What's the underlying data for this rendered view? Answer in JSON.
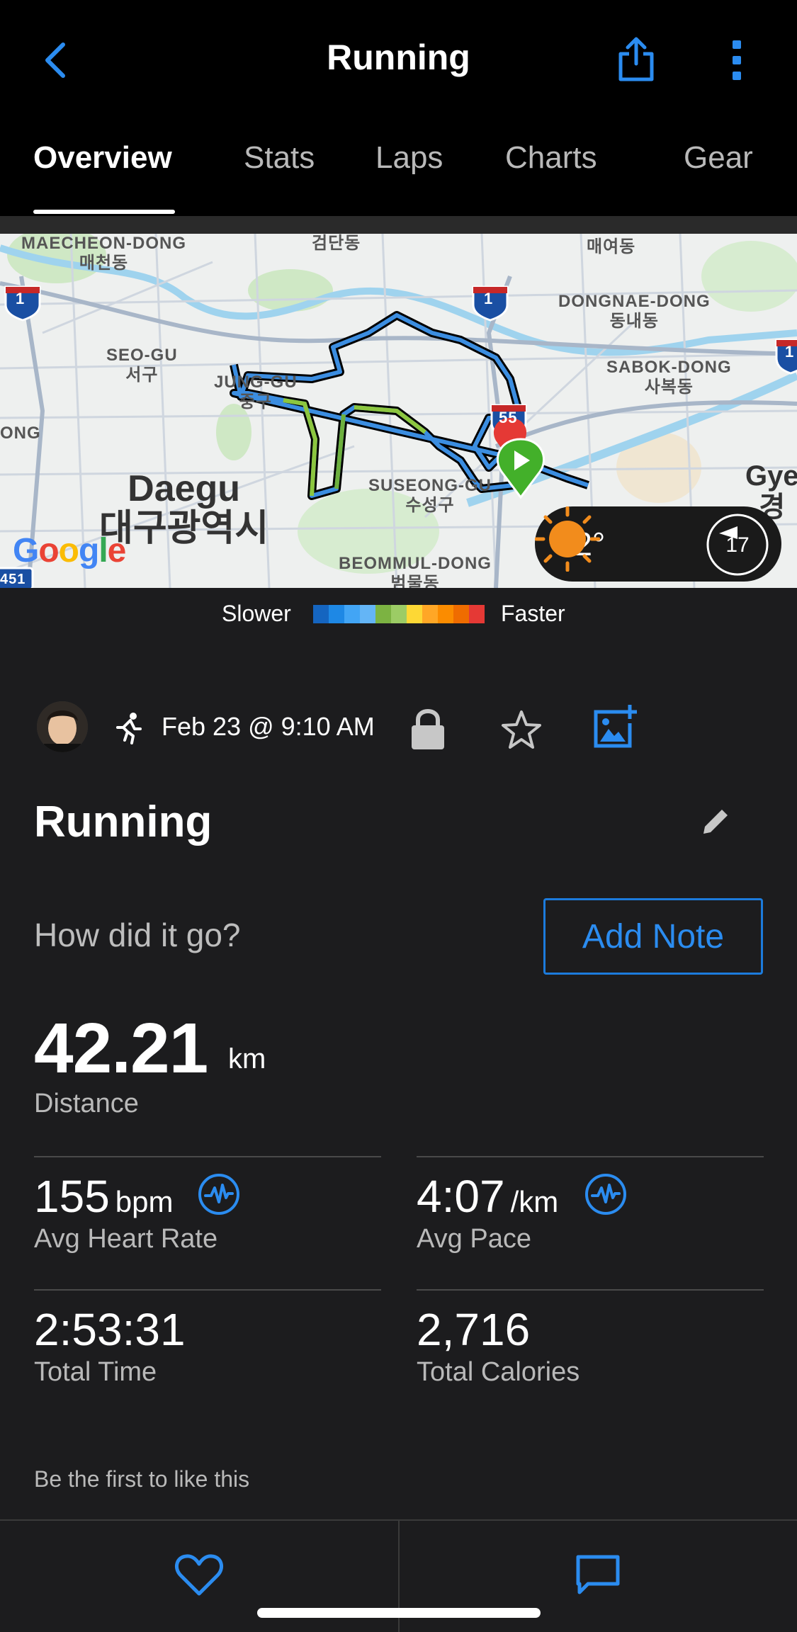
{
  "header": {
    "title": "Running",
    "back_icon": "chevron-left-icon",
    "share_icon": "share-icon",
    "more_icon": "more-vertical-icon"
  },
  "tabs": [
    {
      "label": "Overview",
      "active": true
    },
    {
      "label": "Stats",
      "active": false
    },
    {
      "label": "Laps",
      "active": false
    },
    {
      "label": "Charts",
      "active": false
    },
    {
      "label": "Gear",
      "active": false
    }
  ],
  "map": {
    "labels": {
      "maecheon": "MAECHEON-DONG\n매천동",
      "geomdan": "검단동",
      "maeyeo": "매여동",
      "dongnae": "DONGNAE-DONG\n동내동",
      "seogu": "SEO-GU\n서구",
      "junggu": "JUNG-GU\n중구",
      "sabok": "SABOK-DONG\n사복동",
      "ong": "ONG",
      "daegu": "Daegu\n대구광역시",
      "suseong": "SUSEONG-GU\n수성구",
      "beommul": "BEOMMUL-DONG\n범물동",
      "gye": "Gye\n경",
      "shield_1a": "1",
      "shield_1b": "1",
      "shield_1c": "1",
      "shield_55": "55",
      "shield_451": "451"
    },
    "google": "Google"
  },
  "weather": {
    "temperature": "-2°",
    "condition_icon": "sun-icon",
    "wind_speed": "17"
  },
  "legend": {
    "slower": "Slower",
    "faster": "Faster",
    "colors": [
      "#1565c0",
      "#1e88e5",
      "#42a5f5",
      "#64b5f6",
      "#7cb342",
      "#9ccc65",
      "#fdd835",
      "#ffa726",
      "#fb8c00",
      "#ef6c00",
      "#e53935"
    ]
  },
  "activity": {
    "date": "Feb 23 @ 9:10 AM",
    "name": "Running",
    "prompt": "How did it go?",
    "add_note": "Add Note",
    "distance_value": "42.21",
    "distance_unit": "km",
    "distance_label": "Distance",
    "stats": {
      "hr_value": "155",
      "hr_unit": "bpm",
      "hr_label": "Avg Heart Rate",
      "pace_value": "4:07",
      "pace_unit": "/km",
      "pace_label": "Avg Pace",
      "time_value": "2:53:31",
      "time_label": "Total Time",
      "cal_value": "2,716",
      "cal_label": "Total Calories"
    },
    "likes": "Be the first to like this"
  },
  "colors": {
    "accent": "#2b8cf0",
    "background": "#1c1c1e",
    "header": "#000000",
    "start_marker": "#43b02a",
    "end_marker": "#e53935"
  }
}
